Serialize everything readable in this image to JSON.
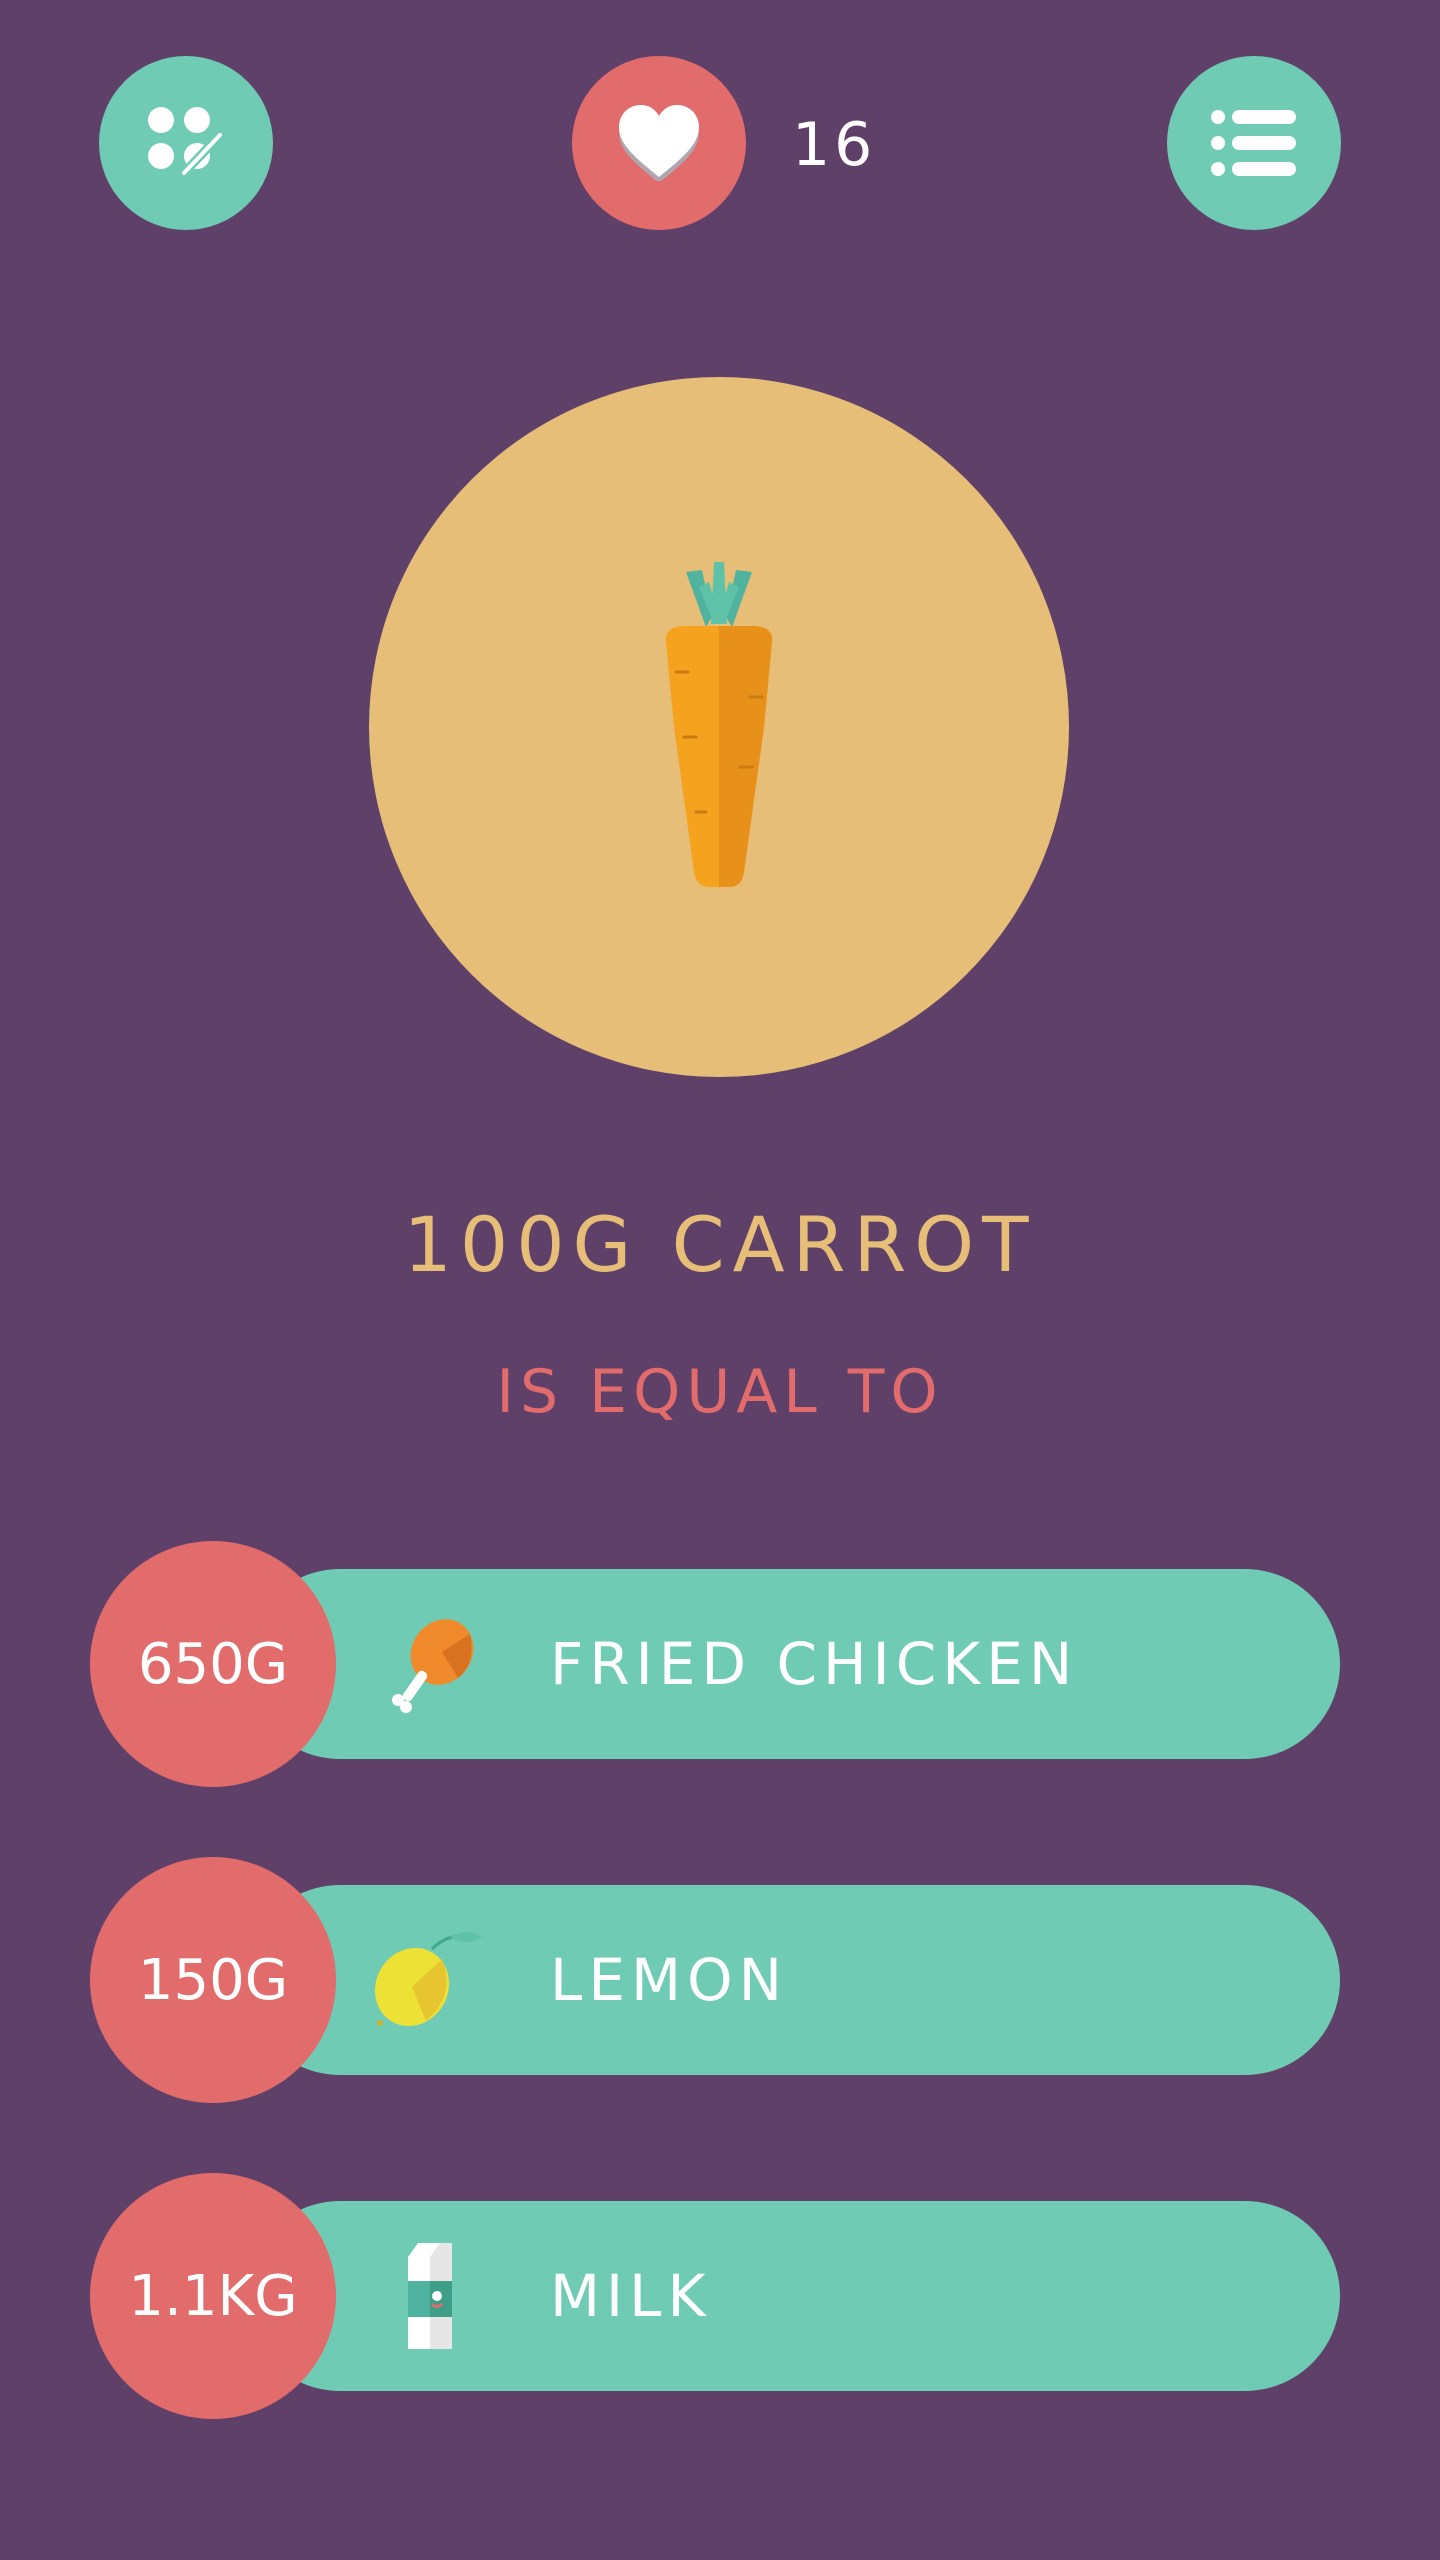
{
  "header": {
    "left_button_icon": "grid-edit-icon",
    "favorite_icon": "heart-icon",
    "favorite_count": "16",
    "right_button_icon": "list-icon"
  },
  "hero": {
    "icon": "carrot-icon",
    "title": "100G CARROT",
    "subtitle": "IS EQUAL TO"
  },
  "equivalents": [
    {
      "amount": "650G",
      "label": "FRIED CHICKEN",
      "icon": "chicken-leg-icon"
    },
    {
      "amount": "150G",
      "label": "LEMON",
      "icon": "lemon-icon"
    },
    {
      "amount": "1.1KG",
      "label": "MILK",
      "icon": "milk-carton-icon"
    }
  ],
  "colors": {
    "background": "#5e4068",
    "teal": "#70cbb4",
    "coral": "#e26b6b",
    "sand": "#e6be78"
  }
}
